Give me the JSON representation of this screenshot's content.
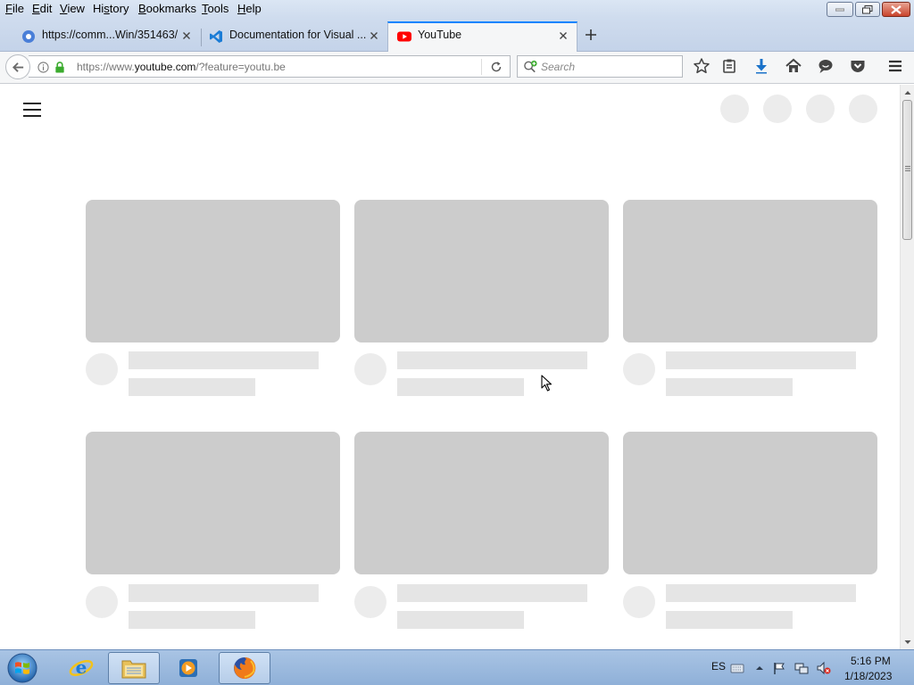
{
  "menubar": {
    "items": [
      "File",
      "Edit",
      "View",
      "History",
      "Bookmarks",
      "Tools",
      "Help"
    ],
    "accesskeys": [
      "F",
      "E",
      "V",
      "s",
      "B",
      "T",
      "H"
    ]
  },
  "tabs": [
    {
      "label": "https://comm...Win/351463/",
      "icon": "chrome-style-tab-icon"
    },
    {
      "label": "Documentation for Visual ...",
      "icon": "vscode-icon"
    },
    {
      "label": "YouTube",
      "icon": "youtube-icon",
      "active": true
    }
  ],
  "navbar": {
    "url_prefix": "https://www.",
    "url_domain": "youtube.com",
    "url_suffix": "/?feature=youtu.be",
    "search_placeholder": "Search"
  },
  "taskbar": {
    "language": "ES",
    "time": "5:16 PM",
    "date": "1/18/2023"
  },
  "colors": {
    "accent": "#0a84ff",
    "skeleton_thumb": "#cccccc",
    "skeleton_line": "#e5e5e5",
    "skeleton_circle": "#ececec"
  }
}
